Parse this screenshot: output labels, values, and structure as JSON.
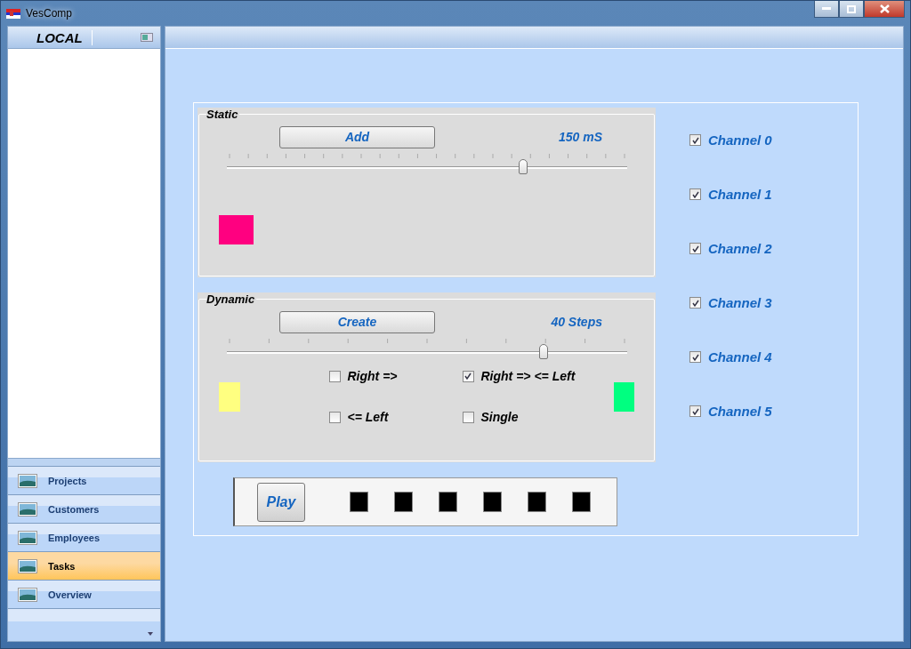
{
  "window": {
    "title": "VesComp"
  },
  "sidebar": {
    "header": "LOCAL",
    "items": [
      {
        "label": "Projects",
        "selected": false
      },
      {
        "label": "Customers",
        "selected": false
      },
      {
        "label": "Employees",
        "selected": false
      },
      {
        "label": "Tasks",
        "selected": true
      },
      {
        "label": "Overview",
        "selected": false
      }
    ]
  },
  "static": {
    "title": "Static",
    "button": "Add",
    "reading": "150 mS",
    "level": 0.74,
    "indicator": {
      "color": "#ff0080"
    }
  },
  "dynamic": {
    "title": "Dynamic",
    "button": "Create",
    "reading": "40 Steps",
    "level": 0.79,
    "indicators": [
      {
        "color": "#ffff80"
      },
      {
        "color": "#00ff80"
      }
    ],
    "options": [
      {
        "label": "Right =>",
        "checked": false
      },
      {
        "label": "Right => <= Left",
        "checked": true
      },
      {
        "label": "<= Left",
        "checked": false
      },
      {
        "label": "Single",
        "checked": false
      }
    ]
  },
  "player": {
    "button": "Play",
    "leds": [
      {
        "color": "#000000"
      },
      {
        "color": "#000000"
      },
      {
        "color": "#000000"
      },
      {
        "color": "#000000"
      },
      {
        "color": "#000000"
      },
      {
        "color": "#000000"
      }
    ]
  },
  "channels": [
    {
      "label": "Channel 0",
      "checked": true
    },
    {
      "label": "Channel 1",
      "checked": true
    },
    {
      "label": "Channel 2",
      "checked": true
    },
    {
      "label": "Channel 3",
      "checked": true
    },
    {
      "label": "Channel 4",
      "checked": true
    },
    {
      "label": "Channel 5",
      "checked": true
    }
  ]
}
